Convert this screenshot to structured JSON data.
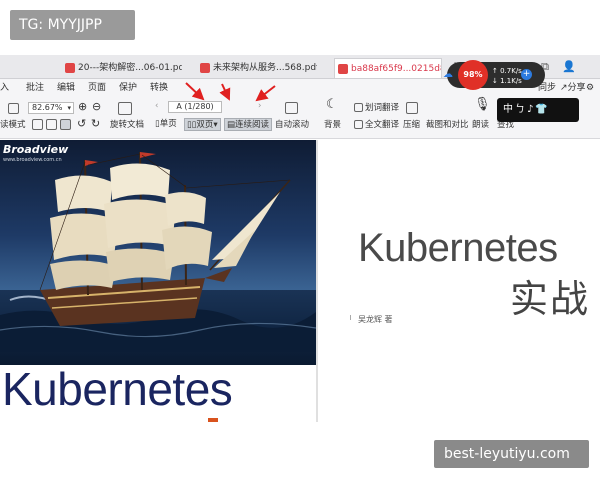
{
  "watermarks": {
    "top": "TG: MYYJJPP",
    "bottom": "best-leyutiyu.com"
  },
  "tabs": [
    {
      "label": "20---架构解密...06-01.pdf",
      "active": false
    },
    {
      "label": "未来架构从服务...568.pdf",
      "active": false
    },
    {
      "label": "ba88af65f9...0215d8.pdf",
      "active": true
    }
  ],
  "menu": {
    "items": [
      "入",
      "批注",
      "编辑",
      "页面",
      "保护",
      "转换"
    ],
    "right_items": [
      "同步",
      "分享"
    ]
  },
  "toolbar": {
    "zoom_value": "82.67%",
    "page_value": "A (1/280)",
    "rotate_doc": "旋转文档",
    "single_page": "单页",
    "double_page": "双页",
    "continuous_read": "连续阅读",
    "auto_scroll": "自动滚动",
    "background": "背景",
    "word_translate": "划词翻译",
    "full_translate": "全文翻译",
    "compress": "压缩",
    "screenshot_compare": "截图和对比",
    "read_aloud": "朗读",
    "find": "查找",
    "view_mode": "读模式"
  },
  "net_widget": {
    "percent": "98%",
    "up": "0.7K/s",
    "down": "1.1K/s",
    "plus": "+"
  },
  "ime": {
    "text": "中ㄅ♪👕"
  },
  "document": {
    "cover": {
      "publisher": "Broadview",
      "publisher_sub": "www.broadview.com.cn",
      "title": "Kubernetes"
    },
    "title_page": {
      "title": "Kubernetes",
      "subtitle": "实战",
      "author": "吴龙辉 著"
    }
  },
  "colors": {
    "accent": "#d9384b",
    "annotation_arrow": "#e02020",
    "cover_title": "#1a2560"
  }
}
